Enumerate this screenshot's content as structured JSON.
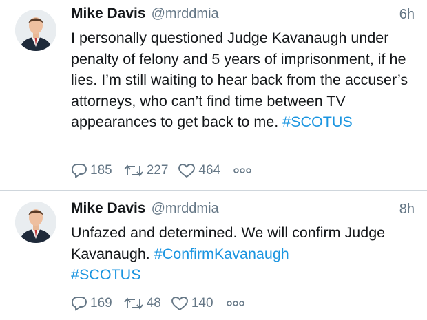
{
  "tweets": [
    {
      "author_name": "Mike Davis",
      "handle": "@mrddmia",
      "time": "6h",
      "text_segments": [
        "I personally questioned Judge Kavanaugh under penalty of felony and 5 years of imprisonment, if he lies. I’m still waiting to hear back from the accuser’s attorneys, who can’t find time between TV appearances to get back to me. "
      ],
      "hashtags": [
        "#SCOTUS"
      ],
      "replies": "185",
      "retweets": "227",
      "likes": "464",
      "icons": {
        "reply": "reply-icon",
        "retweet": "retweet-icon",
        "like": "heart-icon",
        "more": "more-options-icon"
      }
    },
    {
      "author_name": "Mike Davis",
      "handle": "@mrddmia",
      "time": "8h",
      "text_lead": "Unfazed and determined. We will confirm Judge Kavanaugh. ",
      "hashtags": [
        "#ConfirmKavanaugh",
        "#SCOTUS"
      ],
      "replies": "169",
      "retweets": "48",
      "likes": "140",
      "icons": {
        "reply": "reply-icon",
        "retweet": "retweet-icon",
        "like": "heart-icon",
        "more": "more-options-icon"
      }
    }
  ],
  "colors": {
    "text": "#14171a",
    "muted": "#657786",
    "link": "#1b95e0",
    "divider": "#cfd6dc"
  }
}
